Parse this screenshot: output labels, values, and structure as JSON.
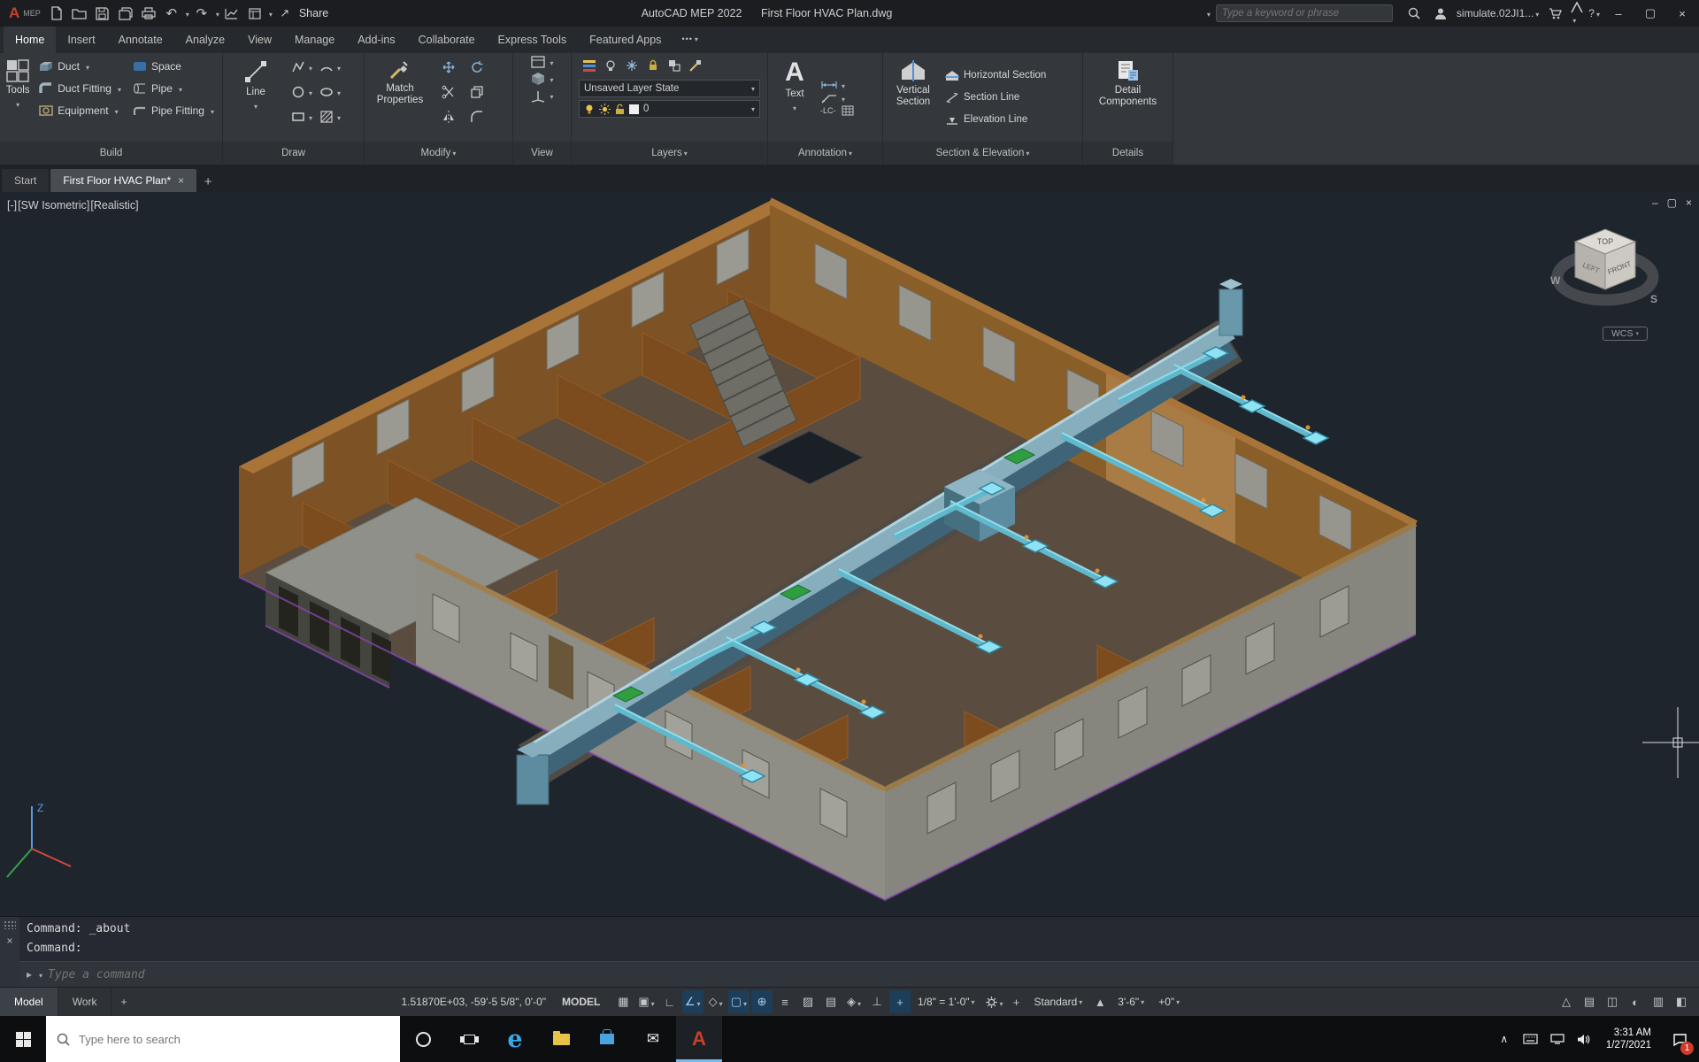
{
  "colors": {
    "accent_red_logo": "#c8402a",
    "ribbon_bg": "#34383d",
    "viewport_bg": "#1f252d",
    "duct_cyan": "#5fb8cc",
    "trunk_blue": "#86aebd",
    "wall_brown": "#7d5224",
    "exterior_gray": "#8e8e86",
    "status_on_blue": "#9fd0f8",
    "taskbar_bg": "#0c0e10"
  },
  "titlebar": {
    "logo_letter": "A",
    "logo_product": "MEP",
    "share_label": "Share",
    "app_name": "AutoCAD MEP 2022",
    "doc_name": "First Floor HVAC Plan.dwg",
    "search_placeholder": "Type a keyword or phrase",
    "user_name": "simulate.02JI1...",
    "help_glyph": "?",
    "minimize_glyph": "–",
    "restore_glyph": "▢",
    "close_glyph": "×"
  },
  "ribbon": {
    "tabs": [
      {
        "label": "Home",
        "active": true
      },
      {
        "label": "Insert"
      },
      {
        "label": "Annotate"
      },
      {
        "label": "Analyze"
      },
      {
        "label": "View"
      },
      {
        "label": "Manage"
      },
      {
        "label": "Add-ins"
      },
      {
        "label": "Collaborate"
      },
      {
        "label": "Express Tools"
      },
      {
        "label": "Featured Apps"
      }
    ],
    "panels": {
      "build": {
        "label": "Build",
        "tools_label": "Tools",
        "col1": [
          {
            "label": "Duct",
            "caret": true
          },
          {
            "label": "Duct Fitting",
            "caret": true
          },
          {
            "label": "Equipment",
            "caret": true
          }
        ],
        "col2": [
          {
            "label": "Space",
            "caret": false
          },
          {
            "label": "Pipe",
            "caret": true
          },
          {
            "label": "Pipe Fitting",
            "caret": true
          }
        ]
      },
      "draw": {
        "label": "Draw",
        "line_label": "Line"
      },
      "modify": {
        "label": "Modify",
        "match_label": "Match Properties"
      },
      "view": {
        "label": "View"
      },
      "layers": {
        "label": "Layers",
        "state_value": "Unsaved Layer State",
        "current_layer": "0"
      },
      "annotation": {
        "label": "Annotation",
        "text_label": "Text",
        "lc_label": "-LC-"
      },
      "section": {
        "label": "Section & Elevation",
        "vertical_label": "Vertical Section",
        "horizontal_label": "Horizontal Section",
        "section_line_label": "Section Line",
        "elevation_line_label": "Elevation Line"
      },
      "details": {
        "label": "Details",
        "detail_label": "Detail Components"
      }
    }
  },
  "filetabs": [
    {
      "label": "Start"
    },
    {
      "label": "First Floor HVAC Plan*",
      "active": true,
      "closable": true
    }
  ],
  "viewport": {
    "controls": [
      "[-]",
      "[SW Isometric]",
      "[Realistic]"
    ],
    "viewcube": {
      "top": "TOP",
      "left": "LEFT",
      "front": "FRONT",
      "w": "W",
      "s": "S"
    },
    "wcs_label": "WCS"
  },
  "command": {
    "history": [
      "Command: _about",
      "Command:"
    ],
    "input_placeholder": "Type a command"
  },
  "layout_tabs": [
    {
      "label": "Model",
      "active": true
    },
    {
      "label": "Work"
    }
  ],
  "statusbar": {
    "coords": "1.51870E+03, -59'-5 5/8\", 0'-0\"",
    "model_label": "MODEL",
    "icons_mid": [
      {
        "name": "grid-display-icon",
        "glyph": "▦"
      },
      {
        "name": "snap-mode-icon",
        "glyph": "▣",
        "caret": true
      },
      {
        "name": "ortho-mode-icon",
        "glyph": "∟"
      },
      {
        "name": "polar-tracking-icon",
        "glyph": "∠",
        "caret": true,
        "on": true
      },
      {
        "name": "isodraft-icon",
        "glyph": "◇",
        "caret": true
      },
      {
        "name": "object-snap-icon",
        "glyph": "▢",
        "caret": true,
        "on": true
      },
      {
        "name": "object-snap-tracking-icon",
        "glyph": "⊕",
        "on": true
      },
      {
        "name": "lineweight-icon",
        "glyph": "≡"
      },
      {
        "name": "transparency-icon",
        "glyph": "▨"
      },
      {
        "name": "selection-cycling-icon",
        "glyph": "▤"
      },
      {
        "name": "osnap-3d-icon",
        "glyph": "◈",
        "caret": true
      },
      {
        "name": "dynamic-ucs-icon",
        "glyph": "⊥"
      },
      {
        "name": "dynamic-input-icon",
        "glyph": "+",
        "on": true
      }
    ],
    "scale_value": "1/8\" = 1'-0\"",
    "display_config": "Standard",
    "cut_plane": "3'-6\"",
    "elevation": "+0\"",
    "icons_tail": [
      {
        "name": "annotation-monitor-icon",
        "glyph": "△"
      },
      {
        "name": "quick-properties-icon",
        "glyph": "▤"
      },
      {
        "name": "lock-ui-icon",
        "glyph": "◫"
      },
      {
        "name": "isolate-objects-icon",
        "glyph": "◐"
      },
      {
        "name": "graphics-performance-icon",
        "glyph": "▥"
      },
      {
        "name": "clean-screen-icon",
        "glyph": "◧"
      }
    ]
  },
  "taskbar": {
    "search_placeholder": "Type here to search",
    "app_icons": [
      "start-icon",
      "cortana-icon",
      "task-view-icon",
      "edge-icon",
      "file-explorer-icon",
      "store-icon",
      "mail-icon",
      "autocad-icon"
    ],
    "tray_icons": [
      "hidden-icons-icon",
      "keyboard-icon",
      "network-icon",
      "volume-icon"
    ],
    "clock_time": "3:31 AM",
    "clock_date": "1/27/2021",
    "notification_count": "1"
  }
}
